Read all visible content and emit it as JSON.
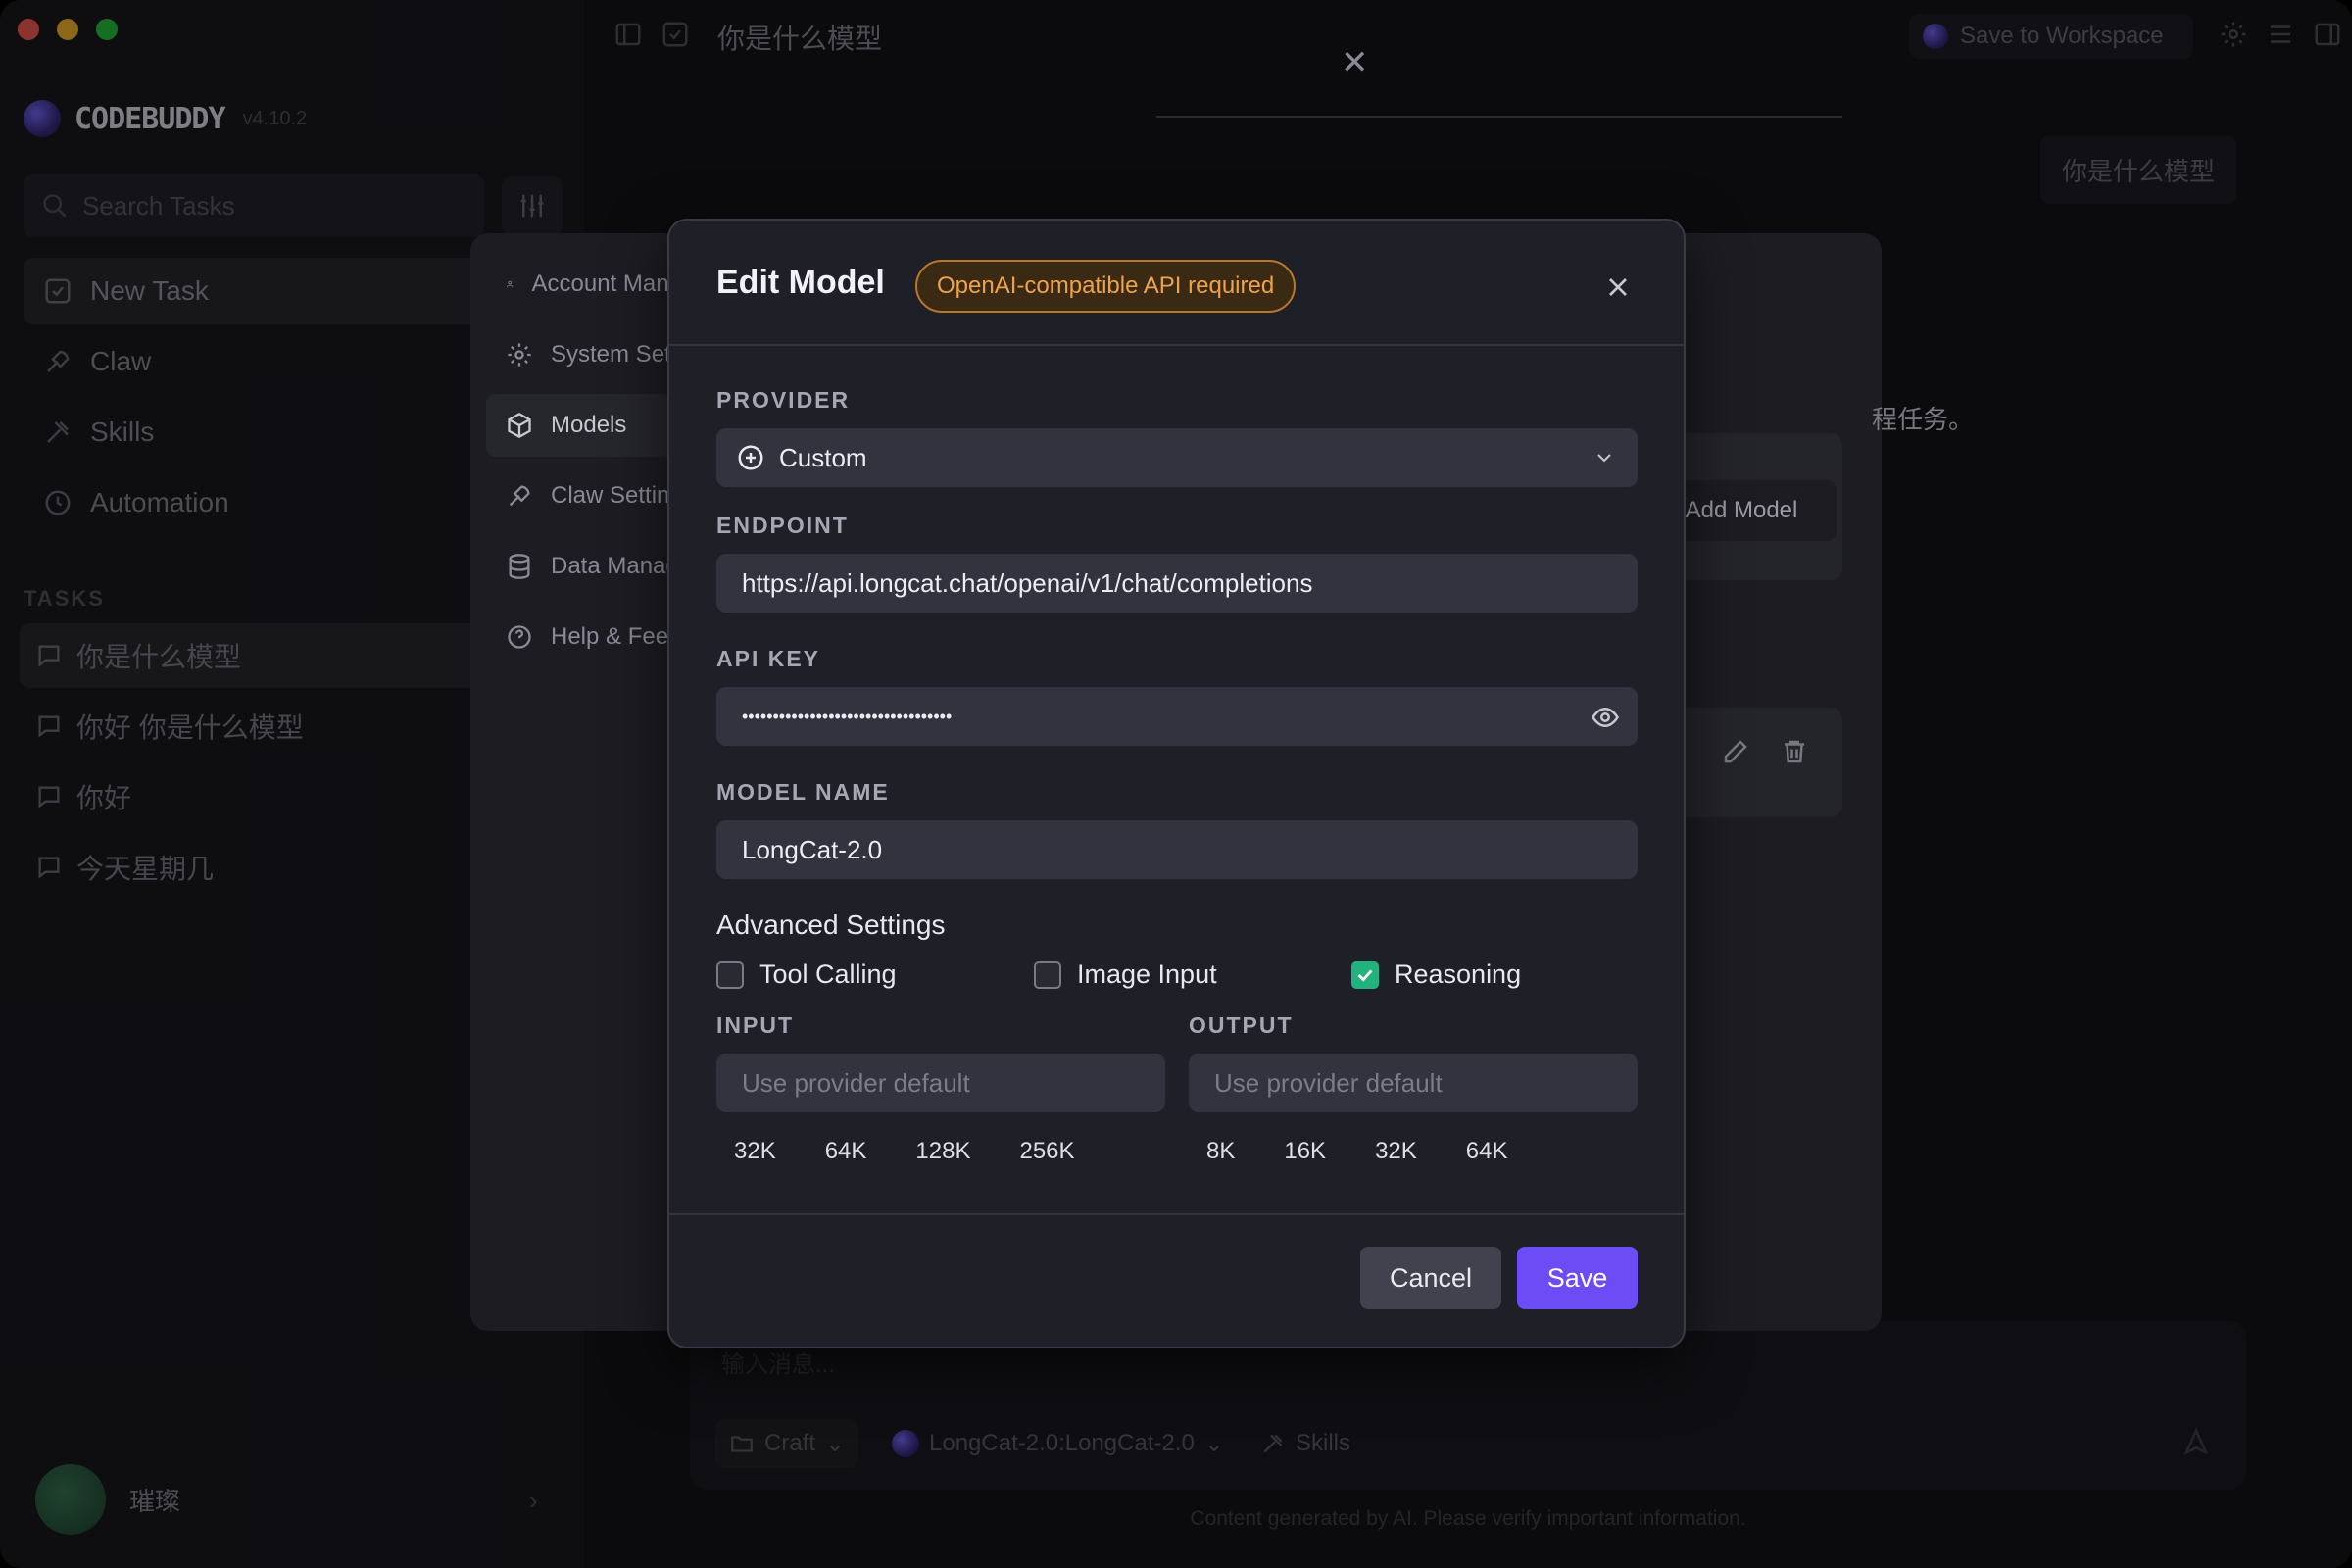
{
  "app": {
    "brand": "CODEBUDDY",
    "version": "v4.10.2"
  },
  "sidebar": {
    "search_placeholder": "Search Tasks",
    "nav": [
      {
        "label": "New Task",
        "icon": "edit-icon"
      },
      {
        "label": "Claw",
        "icon": "claw-icon"
      },
      {
        "label": "Skills",
        "icon": "skills-icon"
      },
      {
        "label": "Automation",
        "icon": "clock-icon"
      }
    ],
    "tasks_label": "TASKS",
    "tasks": [
      {
        "label": "你是什么模型"
      },
      {
        "label": "你好 你是什么模型"
      },
      {
        "label": "你好"
      },
      {
        "label": "今天星期几"
      }
    ],
    "user": {
      "name": "璀璨"
    }
  },
  "topbar": {
    "title": "你是什么模型",
    "save_workspace": "Save to Workspace"
  },
  "chat": {
    "user_message": "你是什么模型",
    "input_placeholder": "输入消息...",
    "mode": "Craft",
    "model": "LongCat-2.0:LongCat-2.0",
    "skills": "Skills",
    "disclaimer": "Content generated by AI. Please verify important information."
  },
  "settings": {
    "nav": [
      {
        "label": "Account Management",
        "icon": "user-icon"
      },
      {
        "label": "System Settings",
        "icon": "gear-icon"
      },
      {
        "label": "Models",
        "icon": "cube-icon"
      },
      {
        "label": "Claw Settings",
        "icon": "claw-icon"
      },
      {
        "label": "Data Management",
        "icon": "database-icon"
      },
      {
        "label": "Help & Feedback",
        "icon": "help-icon"
      }
    ],
    "bg_text": "程任务。",
    "add_model": "Add Model"
  },
  "modal": {
    "title": "Edit Model",
    "badge": "OpenAI-compatible API required",
    "provider_label": "PROVIDER",
    "provider_value": "Custom",
    "endpoint_label": "ENDPOINT",
    "endpoint_value": "https://api.longcat.chat/openai/v1/chat/completions",
    "apikey_label": "API KEY",
    "apikey_value": "••••••••••••••••••••••••••••••••••",
    "model_name_label": "MODEL NAME",
    "model_name_value": "LongCat-2.0",
    "advanced_label": "Advanced Settings",
    "checkboxes": [
      {
        "label": "Tool Calling",
        "checked": false
      },
      {
        "label": "Image Input",
        "checked": false
      },
      {
        "label": "Reasoning",
        "checked": true
      }
    ],
    "input_label": "INPUT",
    "input_placeholder": "Use provider default",
    "input_presets": [
      "32K",
      "64K",
      "128K",
      "256K"
    ],
    "output_label": "OUTPUT",
    "output_placeholder": "Use provider default",
    "output_presets": [
      "8K",
      "16K",
      "32K",
      "64K"
    ],
    "cancel": "Cancel",
    "save": "Save"
  },
  "colors": {
    "accent": "#6b4cf5",
    "badge": "#f0a248",
    "check": "#22b27d"
  }
}
